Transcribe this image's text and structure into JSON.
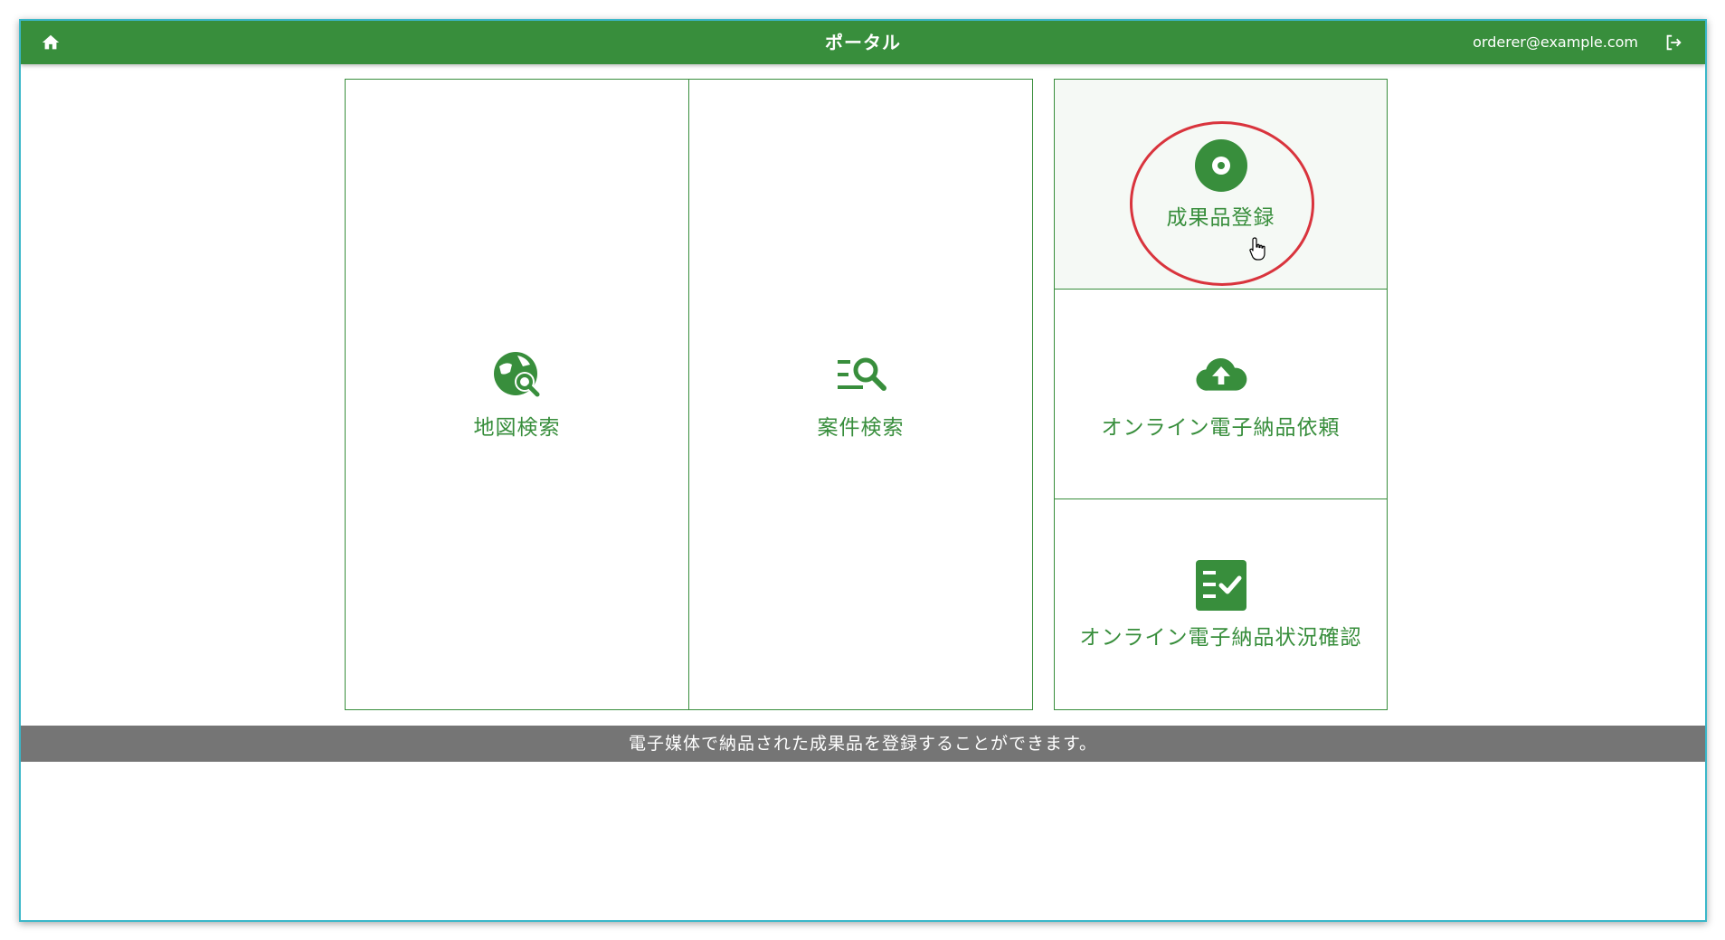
{
  "header": {
    "title": "ポータル",
    "user_email": "orderer@example.com",
    "home_icon": "home-icon",
    "logout_icon": "logout-icon"
  },
  "tiles": {
    "map_search": {
      "label": "地図検索",
      "icon": "map-search-icon"
    },
    "case_search": {
      "label": "案件検索",
      "icon": "list-search-icon"
    },
    "deliverable_register": {
      "label": "成果品登録",
      "icon": "disc-icon"
    },
    "online_delivery_request": {
      "label": "オンライン電子納品依頼",
      "icon": "cloud-upload-icon"
    },
    "online_delivery_status": {
      "label": "オンライン電子納品状況確認",
      "icon": "checklist-icon"
    }
  },
  "status_message": "電子媒体で納品された成果品を登録することができます。",
  "colors": {
    "primary": "#388e3c",
    "status_bar": "#757575",
    "highlight_ring": "#d9343d",
    "window_border": "#3ab7c9"
  }
}
